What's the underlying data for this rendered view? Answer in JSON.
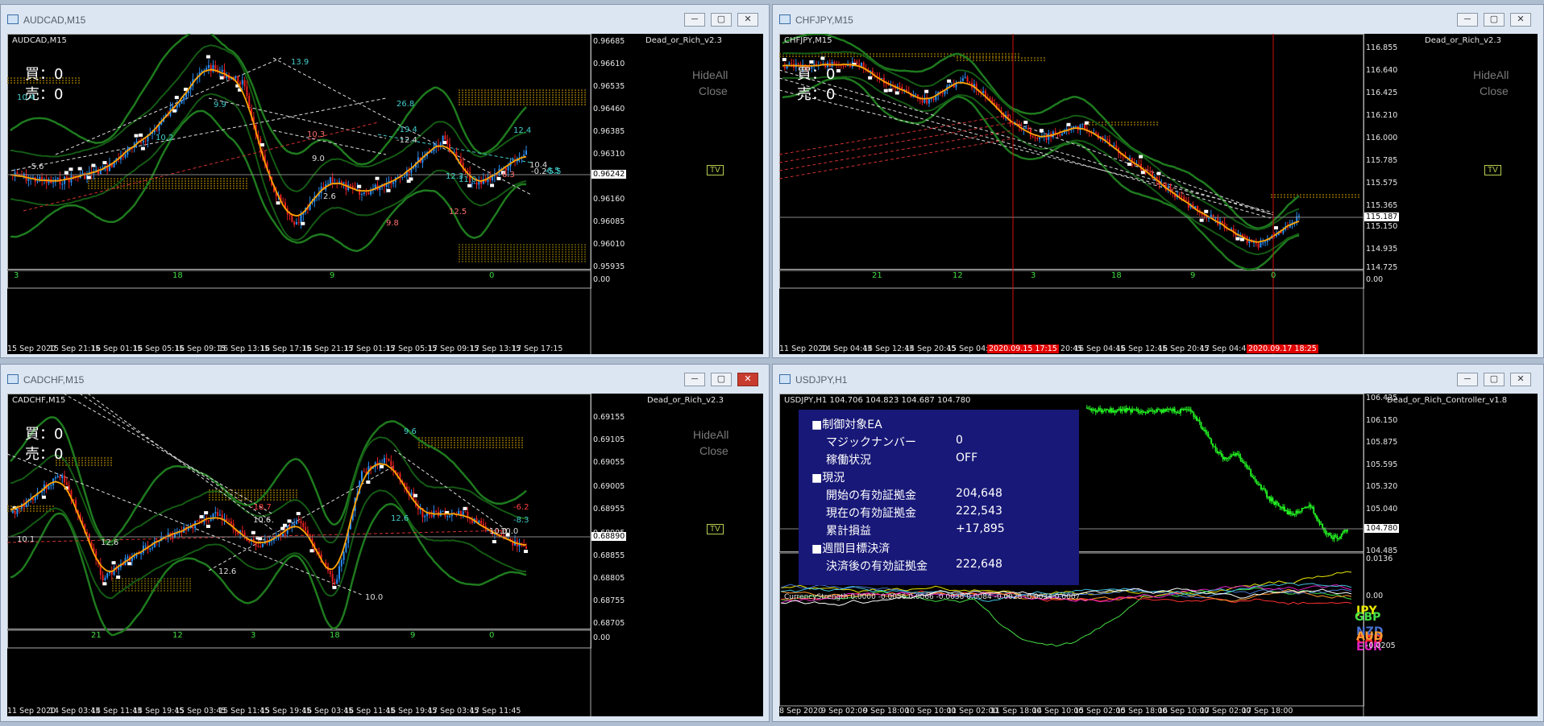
{
  "windows": {
    "w1": {
      "title": "AUDCAD,M15",
      "symbol": "AUDCAD,M15",
      "ea": "Dead_or_Rich_v2.3",
      "buy": "買：0",
      "sell": "売：0",
      "hide_all": "HideAll",
      "close_all": "Close",
      "tv": "TV",
      "prices": [
        "0.96685",
        "0.96610",
        "0.96535",
        "0.96460",
        "0.96385",
        "0.96310",
        "0.96160",
        "0.96085",
        "0.96010",
        "0.95935",
        "0.00"
      ],
      "current_price": "0.96242",
      "times": [
        "15 Sep 2020",
        "15 Sep 21:15",
        "16 Sep 01:15",
        "16 Sep 05:15",
        "16 Sep 09:15",
        "16 Sep 13:15",
        "16 Sep 17:15",
        "16 Sep 21:15",
        "17 Sep 01:15",
        "17 Sep 05:15",
        "17 Sep 09:15",
        "17 Sep 13:15",
        "17 Sep 17:15"
      ],
      "sub_nums": [
        "3",
        "18",
        "9",
        "0"
      ],
      "labels": [
        "10.4",
        "9.9",
        "10.2",
        "13.9",
        "26.8",
        "-19.4",
        "-12.4",
        "10.3",
        "9.0",
        "-5.6",
        "9.8",
        "12.5",
        "-6.5",
        "10.4",
        "-0.2",
        "-5.5",
        "12.4",
        "12.3",
        "11.0",
        "6.3",
        "2.6"
      ]
    },
    "w2": {
      "title": "CHFJPY,M15",
      "symbol": "CHFJPY,M15",
      "ea": "Dead_or_Rich_v2.3",
      "buy": "買：0",
      "sell": "売：0",
      "hide_all": "HideAll",
      "close_all": "Close",
      "tv": "TV",
      "prices": [
        "116.855",
        "116.640",
        "116.425",
        "116.210",
        "116.000",
        "115.785",
        "115.575",
        "115.365",
        "115.187",
        "115.150",
        "114.935",
        "114.725",
        "0.00"
      ],
      "current_price": "115.187",
      "times": [
        "11 Sep 2020",
        "14 Sep 04:45",
        "14 Sep 12:45",
        "14 Sep 20:45",
        "15 Sep 04:45",
        "Sep 20:45",
        "16 Sep 04:45",
        "16 Sep 12:45",
        "16 Sep 20:45",
        "17 Sep 04:45"
      ],
      "red_times": [
        "2020.09.15 17:15",
        "2020.09.17 18:25"
      ],
      "sub_nums": [
        "21",
        "12",
        "3",
        "18",
        "9",
        "0"
      ]
    },
    "w3": {
      "title": "CADCHF,M15",
      "symbol": "CADCHF,M15",
      "ea": "Dead_or_Rich_v2.3",
      "buy": "買：0",
      "sell": "売：0",
      "hide_all": "HideAll",
      "close_all": "Close",
      "tv": "TV",
      "prices": [
        "0.69155",
        "0.69105",
        "0.69055",
        "0.69005",
        "0.68955",
        "0.68905",
        "0.68855",
        "0.68805",
        "0.68755",
        "0.68705",
        "0.00"
      ],
      "current_price": "0.68890",
      "times": [
        "11 Sep 2020",
        "14 Sep 03:45",
        "14 Sep 11:45",
        "14 Sep 19:45",
        "15 Sep 03:45",
        "15 Sep 11:45",
        "15 Sep 19:45",
        "16 Sep 03:45",
        "16 Sep 11:45",
        "16 Sep 19:45",
        "17 Sep 03:45",
        "17 Sep 11:45"
      ],
      "sub_nums": [
        "21",
        "12",
        "3",
        "18",
        "9",
        "0"
      ],
      "labels": [
        "10.1",
        "12.6",
        "12.6",
        "-18.7",
        "10.6",
        "12.6",
        "9.6",
        "10.0",
        "-6.2",
        "10.0",
        "-8.3",
        "10.0"
      ]
    },
    "w4": {
      "title": "USDJPY,H1",
      "symbol": "USDJPY,H1  104.706 104.823 104.687 104.780",
      "ea": "Dead_or_Rich_Controller_v1.8",
      "prices": [
        "106.425",
        "106.150",
        "105.875",
        "105.595",
        "105.320",
        "105.040",
        "104.780",
        "104.485"
      ],
      "current_price": "104.780",
      "strength_prices": [
        "0.0136",
        "0.00",
        "-0.0205"
      ],
      "times": [
        "8 Sep 2020",
        "9 Sep 02:00",
        "9 Sep 18:00",
        "10 Sep 10:00",
        "11 Sep 02:00",
        "11 Sep 18:00",
        "14 Sep 10:00",
        "15 Sep 02:00",
        "15 Sep 18:00",
        "16 Sep 10:00",
        "17 Sep 02:00",
        "17 Sep 18:00"
      ],
      "strength_header": "CurrencyStrength  0.0000 -0.0056 0.0066 -0.0038 0.0084 -0.0028 -0.0034 0.0007",
      "panel": {
        "h1": "■制御対象EA",
        "magic_label": "マジックナンバー",
        "magic_value": "0",
        "status_label": "稼働状況",
        "status_value": "OFF",
        "h2": "■現況",
        "start_label": "開始の有効証拠金",
        "start_value": "204,648",
        "now_label": "現在の有効証拠金",
        "now_value": "222,543",
        "pl_label": "累計損益",
        "pl_value": "+17,895",
        "h3": "■週間目標決済",
        "after_label": "決済後の有効証拠金",
        "after_value": "222,648"
      },
      "strength_labels": {
        "jpy": "JPY",
        "gbp": "GBP",
        "nzd": "NZD",
        "cad": "CAD",
        "aud": "AUD",
        "eur": "EUR"
      }
    }
  },
  "colors": {
    "up": "#2a8cf0",
    "down": "#e82020",
    "ma": "#ffa500",
    "band": "#1e7a1e",
    "usdjpy": "#22ee22"
  }
}
